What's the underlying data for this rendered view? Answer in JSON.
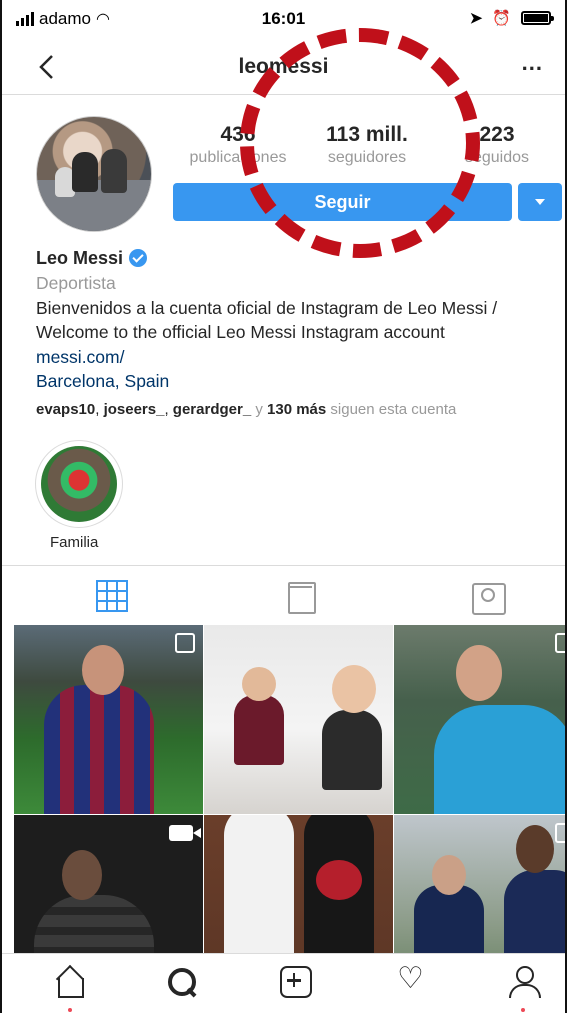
{
  "status_bar": {
    "carrier": "adamo",
    "time": "16:01"
  },
  "nav": {
    "username": "leomessi",
    "more": "..."
  },
  "stats": [
    {
      "value": "436",
      "label": "publicaciones"
    },
    {
      "value": "113 mill.",
      "label": "seguidores"
    },
    {
      "value": "223",
      "label": "seguidos"
    }
  ],
  "follow_button": "Seguir",
  "bio": {
    "name": "Leo Messi",
    "category": "Deportista",
    "text_line1": "Bienvenidos a la cuenta oficial de Instagram de Leo Messi /",
    "text_line2": "Welcome to the official Leo Messi Instagram account",
    "link": "messi.com/",
    "location": "Barcelona, Spain",
    "followed_by": {
      "user1": "evaps10",
      "user2": "joseers_",
      "user3": "gerardger_",
      "connector": "y",
      "more": "130 más",
      "suffix": "siguen esta cuenta"
    }
  },
  "highlights": [
    {
      "label": "Familia"
    }
  ],
  "profile_tabs": [
    "grid-icon",
    "feed-icon",
    "tagged-icon"
  ],
  "bottom_nav": [
    "home-icon",
    "search-icon",
    "add-icon",
    "heart-icon",
    "profile-icon"
  ],
  "colors": {
    "accent": "#3897f0",
    "annotation": "#c0101a",
    "muted": "#999999",
    "link": "#003569"
  }
}
